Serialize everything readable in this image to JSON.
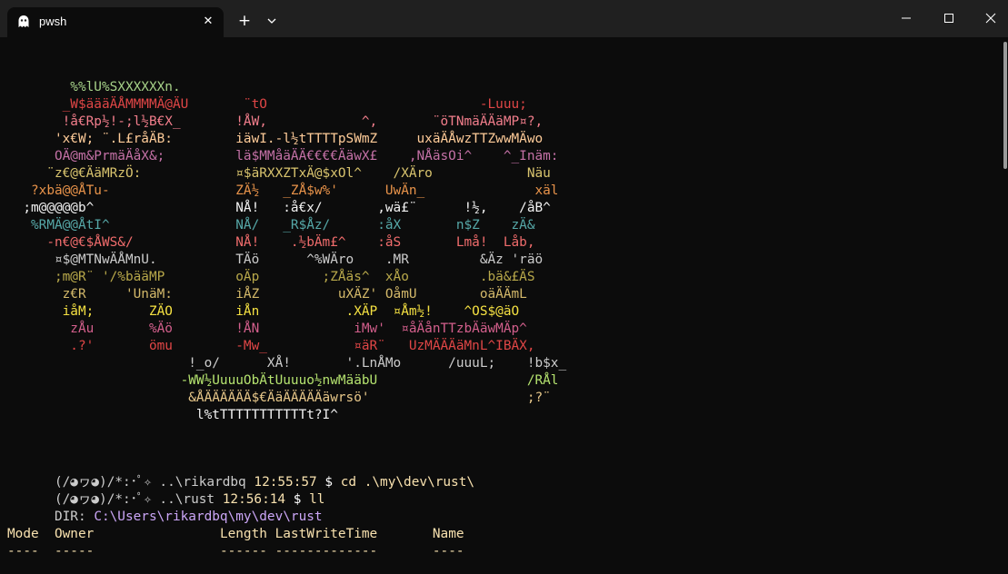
{
  "window": {
    "tab_title": "pwsh",
    "tab_icon": "ghost-icon",
    "new_tab_label": "+",
    "close_tab_label": "✕"
  },
  "colors": {
    "titlebar": "#202020",
    "terminal_bg": "#0c0c0c"
  },
  "ascii_art": [
    {
      "text": "        %%lU%SXXXXXXn.",
      "color": "c-green"
    },
    {
      "text": "       _W$äääÄÅMMMMÄ@ÄU       ¨tO                           -Luuu;",
      "color": "c-red"
    },
    {
      "text": "       !å€Rp½!-;l½B€X_       !ÅW,            ^,       ¨öTNmäÄÄäMP¤?,",
      "color": "c-pink"
    },
    {
      "text": "      'x€W; ¨.L£råÄB:        iäwI.-l½tTTTTpSWmZ     uxäÄÅwzTTZwwMÄwo",
      "color": "c-peach"
    },
    {
      "text": "      OÄ@m&PrmäÄåX&;         lä$MMåäÄÄ€€€€ÄäwX£    ,NÅäsOi^    ^_Inäm:",
      "color": "c-plum"
    },
    {
      "text": "     ¨z€@€ÄäMRzÖ:            ¤$äRXXZTxÄ@$xOl^    /XÄro            Näu",
      "color": "c-gold"
    },
    {
      "text": "   ?xbä@@ÅTu-                ZÄ½   _ZÅ$w%'      UwÄn_              xäl",
      "color": "c-orange"
    },
    {
      "text": "  ;m@@@@@b^                  NÅ!   :å€x/       ,wä£¨      !½,    /åB^",
      "color": "c-white"
    },
    {
      "text": "   %RMÄ@@ÅtI^                NÅ/   _R$Åz/      :åX       n$Z    zÄ&",
      "color": "c-teal"
    },
    {
      "text": "     -n€@€$ÅWS&/             NÅ!    .½bÄm£^    :åS       Lmå!  Låb,",
      "color": "c-red2"
    },
    {
      "text": "      ¤$@MTNwÄÅMnU.          TÄö      ^%WÄro    .MR         &Äz 'räö",
      "color": "c-gray"
    },
    {
      "text": "      ;m@R¨ '/%bääMP         oÄp        ;ZÅäs^  xÅo         .bä&£ÄS",
      "color": "c-olive"
    },
    {
      "text": "       z€R     'UnäM:        iÅZ          uXÄZ' OåmU        oäÄÄmL",
      "color": "c-gold2"
    },
    {
      "text": "       iåM;       ZÄO        iÅn           .XÄP  ¤Åm½!    ^OS$@äO",
      "color": "c-yellow"
    },
    {
      "text": "        zÅu       %Äö        !ÅN            iMw'  ¤åÄånTTzbÄäwMÄp^",
      "color": "c-mauve"
    },
    {
      "text": "        .?'       ömu        -Mw_           ¤äR¨   UzMÄÄÄäMnL^IBÄX,",
      "color": "c-red"
    },
    {
      "text": "                       !_o/      XÅ!       '.LnÅMo      /uuuL;    !b$x_",
      "color": "c-gray"
    },
    {
      "text": "                      -WW½UuuuObÄtUuuuo½nwMääbU                   /RÅl",
      "color": "c-lime"
    },
    {
      "text": "                       &ÅÄÄÄÄÄÄ$€ÄäÄÄÄÄÄäwrsö'                    ;?¨",
      "color": "c-cream"
    },
    {
      "text": "                        l%tTTTTTTTTTTTt?I^",
      "color": "c-white"
    }
  ],
  "prompt_lines": [
    {
      "kaomoji": "(/◕ヮ◕)/*:･ﾟ✧",
      "path": "..\\rikardbq",
      "time": "12:55:57",
      "symbol": "$",
      "command": "cd .\\my\\dev\\rust\\"
    },
    {
      "kaomoji": "(/◕ヮ◕)/*:･ﾟ✧",
      "path": "..\\rust",
      "time": "12:56:14",
      "symbol": "$",
      "command": "ll"
    }
  ],
  "dir_label": "DIR:",
  "dir_path": "C:\\Users\\rikardbq\\my\\dev\\rust",
  "table": {
    "headers": [
      "Mode",
      "Owner",
      "Length",
      "LastWriteTime",
      "Name"
    ],
    "underlines": [
      "----",
      "-----",
      "------",
      "-------------",
      "----"
    ]
  }
}
